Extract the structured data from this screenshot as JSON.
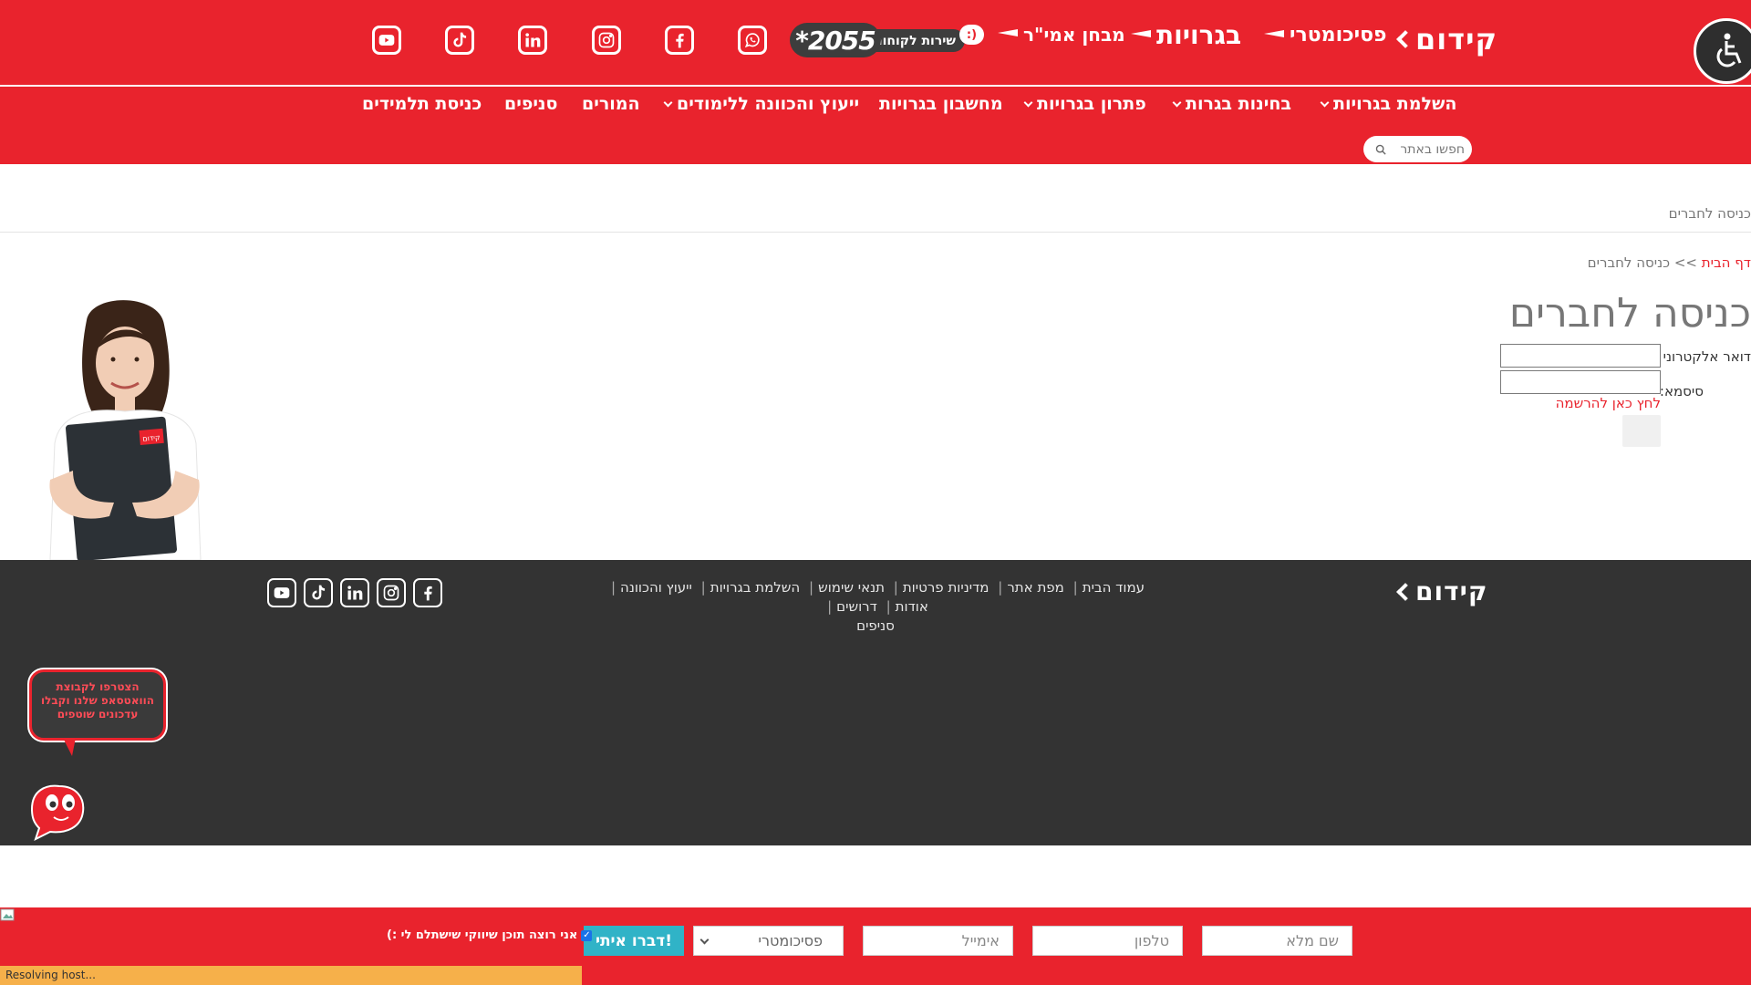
{
  "header": {
    "logo": "קידום",
    "brands": {
      "psychometric": "פסיכומטרי",
      "bagrut": "בגרויות",
      "amir": "מבחן אמי\"ר"
    },
    "service_label": "שירות לקוחות",
    "phone": "*2055",
    "search_placeholder": "חפשו באתר"
  },
  "nav": {
    "items": [
      {
        "label": "השלמת בגרויות",
        "has_dropdown": true
      },
      {
        "label": "בחינות בגרות",
        "has_dropdown": true
      },
      {
        "label": "פתרון בגרויות",
        "has_dropdown": true
      },
      {
        "label": "מחשבון בגרויות",
        "has_dropdown": false
      },
      {
        "label": "ייעוץ והכוונה ללימודים",
        "has_dropdown": true
      },
      {
        "label": "המורים",
        "has_dropdown": false
      },
      {
        "label": "סניפים",
        "has_dropdown": false
      },
      {
        "label": "כניסת תלמידים",
        "has_dropdown": false
      }
    ]
  },
  "content": {
    "page_heading": "כניסה לחברים",
    "breadcrumb": {
      "home": "דף הבית",
      "separator": ">>",
      "current": "כניסה לחברים"
    },
    "title": "כניסה לחברים",
    "email_label": "דואר אלקטרוני",
    "password_label": "סיסמא:",
    "register_link": "לחץ כאן להרשמה",
    "model_badge": "קידום"
  },
  "footer": {
    "logo": "קידום",
    "links": [
      "עמוד הבית",
      "מפת אתר",
      "מדיניות פרטיות",
      "תנאי שימוש",
      "השלמת בגרויות",
      "ייעוץ והכוונה",
      "אודות",
      "דרושים",
      "סניפים"
    ],
    "chat_text": "הצטרפו לקבוצת הוואטסאפ שלנו וקבלו עדכונים שוטפים"
  },
  "lead_form": {
    "fullname_placeholder": "שם מלא",
    "phone_placeholder": "טלפון",
    "email_placeholder": "אימייל",
    "select_value": "פסיכומטרי",
    "submit_label": "דברו איתי!",
    "consent_label": "אני רוצה תוכן שיווקי שישתלם לי :)",
    "consent_checked": true
  },
  "status_bar": "Resolving host...",
  "colors": {
    "brand_red": "#e9232d",
    "footer_dark": "#333333",
    "cta_teal": "#30b3c7"
  },
  "icons": {
    "social": [
      "youtube-icon",
      "tiktok-icon",
      "linkedin-icon",
      "instagram-icon",
      "facebook-icon",
      "whatsapp-icon"
    ],
    "accessibility": "wheelchair-icon"
  }
}
